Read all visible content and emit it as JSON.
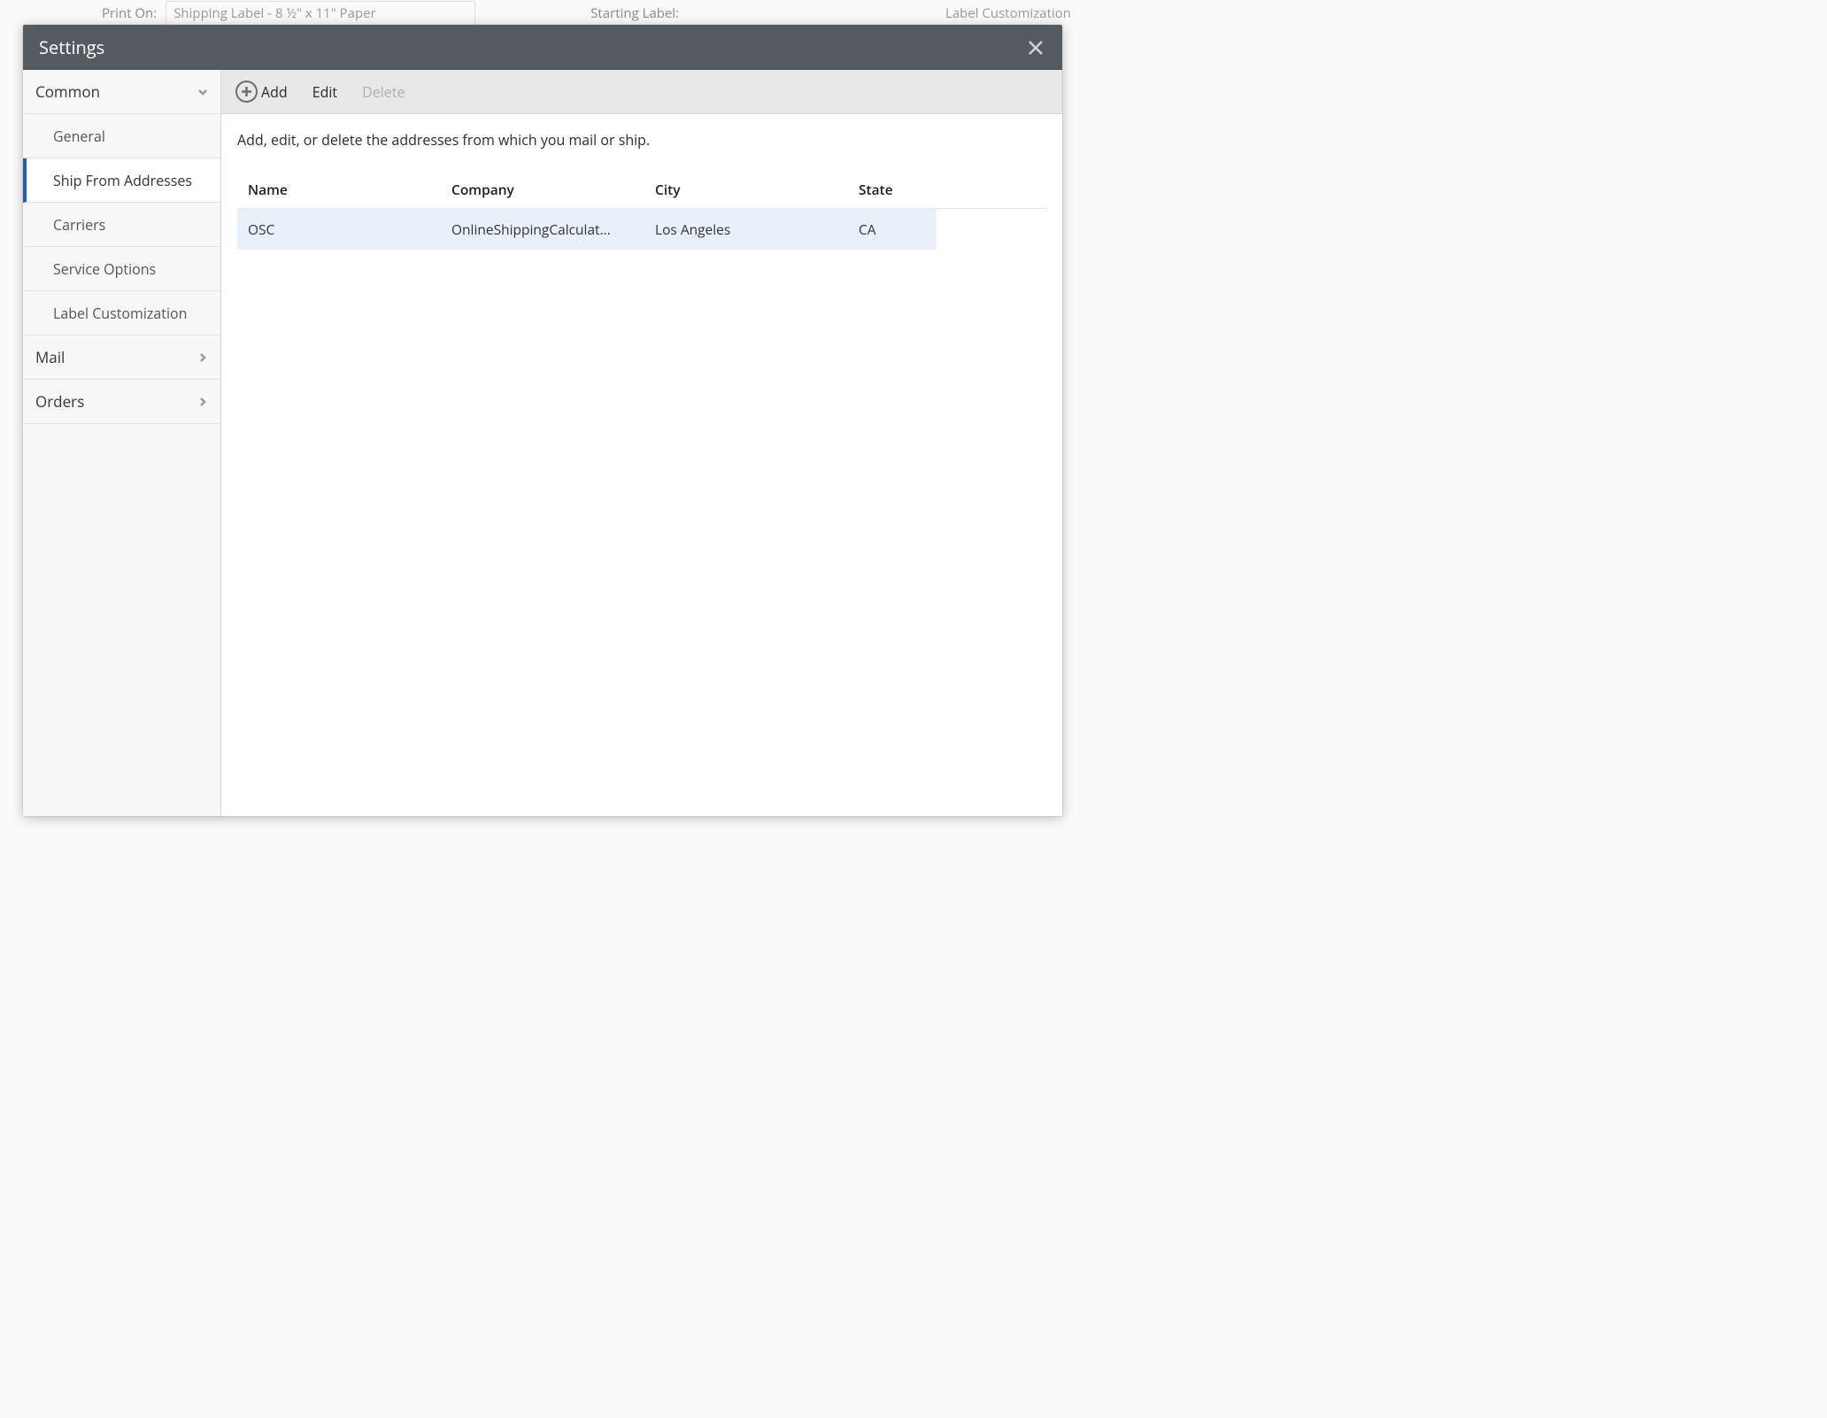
{
  "backdrop": {
    "print_on_label": "Print On:",
    "print_on_value": "Shipping Label - 8 ½\" x 11\" Paper",
    "starting_label": "Starting Label:",
    "label_customization": "Label Customization"
  },
  "modal": {
    "title": "Settings"
  },
  "sidebar": {
    "categories": [
      {
        "label": "Common",
        "expanded": true
      },
      {
        "label": "Mail",
        "expanded": false
      },
      {
        "label": "Orders",
        "expanded": false
      }
    ],
    "common_items": [
      {
        "label": "General",
        "active": false
      },
      {
        "label": "Ship From Addresses",
        "active": true
      },
      {
        "label": "Carriers",
        "active": false
      },
      {
        "label": "Service Options",
        "active": false
      },
      {
        "label": "Label Customization",
        "active": false
      }
    ]
  },
  "toolbar": {
    "add_label": "Add",
    "edit_label": "Edit",
    "delete_label": "Delete"
  },
  "content": {
    "description": "Add, edit, or delete the addresses from which you mail or ship.",
    "columns": {
      "name": "Name",
      "company": "Company",
      "city": "City",
      "state": "State"
    },
    "rows": [
      {
        "name": "OSC",
        "company": "OnlineShippingCalculat...",
        "city": "Los Angeles",
        "state": "CA"
      }
    ]
  }
}
